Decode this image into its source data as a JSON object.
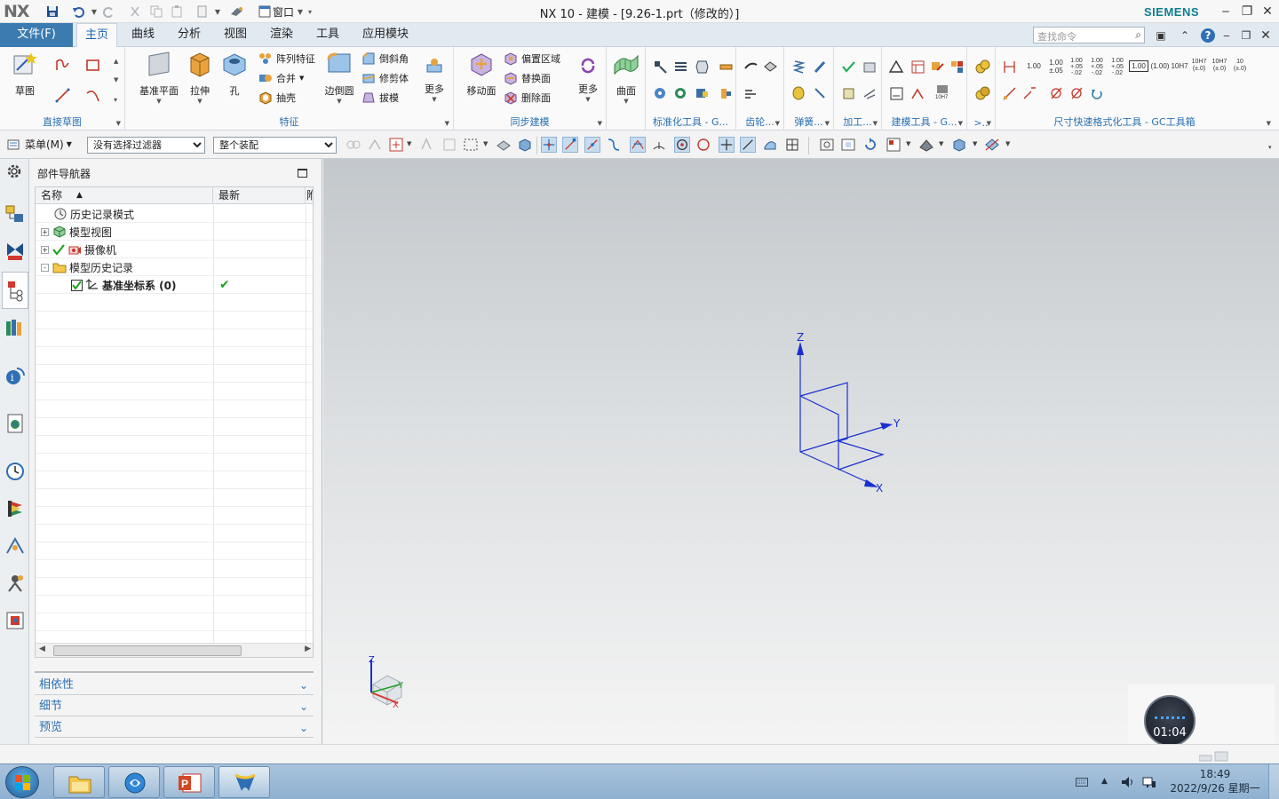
{
  "titlebar": {
    "logo": "NX",
    "title": "NX 10 - 建模 - [9.26-1.prt（修改的）]",
    "window_menu_label": "窗口",
    "brand": "SIEMENS"
  },
  "tabs": {
    "file": "文件(F)",
    "items": [
      "主页",
      "曲线",
      "分析",
      "视图",
      "渲染",
      "工具",
      "应用模块"
    ],
    "active": "主页",
    "search_placeholder": "查找命令"
  },
  "ribbon": {
    "groups": {
      "direct_sketch": "直接草图",
      "feature": "特征",
      "sync_modeling": "同步建模",
      "standard_tools": "标准化工具 - G...",
      "gear": "齿轮...",
      "spring": "弹簧...",
      "machining": "加工...",
      "modeling_tools": "建模工具 - G...",
      "more_small": ">..",
      "dimension_tools": "尺寸快速格式化工具 - GC工具箱"
    },
    "buttons": {
      "sketch": "草图",
      "datum_plane": "基准平面",
      "extrude": "拉伸",
      "hole": "孔",
      "pattern_feature": "阵列特征",
      "unite": "合并",
      "shell": "抽壳",
      "edge_blend": "边倒圆",
      "chamfer": "倒斜角",
      "trim_body": "修剪体",
      "draft": "拔模",
      "more_feature": "更多",
      "move_face": "移动面",
      "offset_region": "偏置区域",
      "replace_face": "替换面",
      "delete_face": "删除面",
      "more_sync": "更多",
      "surface": "曲面"
    },
    "dim_labels": [
      "1.00",
      "1.00\n±.05",
      "1.00\n+.05\n-.02",
      "1.00\n+.05\n-.02",
      "1.00\n+.05\n-.02",
      "1.00",
      "(1.00)",
      "10H7",
      "10H7\n(±.0)",
      "10H7\n(±.0)",
      "10\n(±.0)"
    ],
    "dim_small": "10H7"
  },
  "toolbar": {
    "menu_label": "菜单(M)",
    "filter_value": "没有选择过滤器",
    "scope_value": "整个装配"
  },
  "navigator": {
    "title": "部件导航器",
    "columns": [
      "名称",
      "最新",
      "附"
    ],
    "rows": [
      {
        "label": "历史记录模式",
        "icon": "clock-icon",
        "expand": "",
        "check": false,
        "latest": ""
      },
      {
        "label": "模型视图",
        "icon": "model-views-icon",
        "expand": "+",
        "check": false,
        "latest": ""
      },
      {
        "label": "摄像机",
        "icon": "camera-icon",
        "expand": "+",
        "check": true,
        "latest": ""
      },
      {
        "label": "模型历史记录",
        "icon": "folder-icon",
        "expand": "-",
        "check": false,
        "latest": ""
      },
      {
        "label": "基准坐标系 (0)",
        "icon": "datum-csys-icon",
        "expand": "",
        "check": true,
        "latest": "✔"
      }
    ],
    "panels": [
      "相依性",
      "细节",
      "预览"
    ]
  },
  "graphics": {
    "axis_labels": {
      "z": "Z",
      "y": "Y",
      "x": "X"
    },
    "triad_labels": {
      "z": "Z",
      "y": "Y",
      "x": "X"
    }
  },
  "timer": {
    "value": "01:04"
  },
  "taskbar": {
    "clock_time": "18:49",
    "clock_date": "2022/9/26 星期一",
    "apps": [
      "file-explorer",
      "browser",
      "powerpoint",
      "nx"
    ]
  },
  "colors": {
    "accent": "#3b7bb0",
    "group_label": "#2b70b2",
    "brand": "#0f7e8e",
    "axis_blue": "#1a2fd0",
    "check_green": "#22a022"
  }
}
